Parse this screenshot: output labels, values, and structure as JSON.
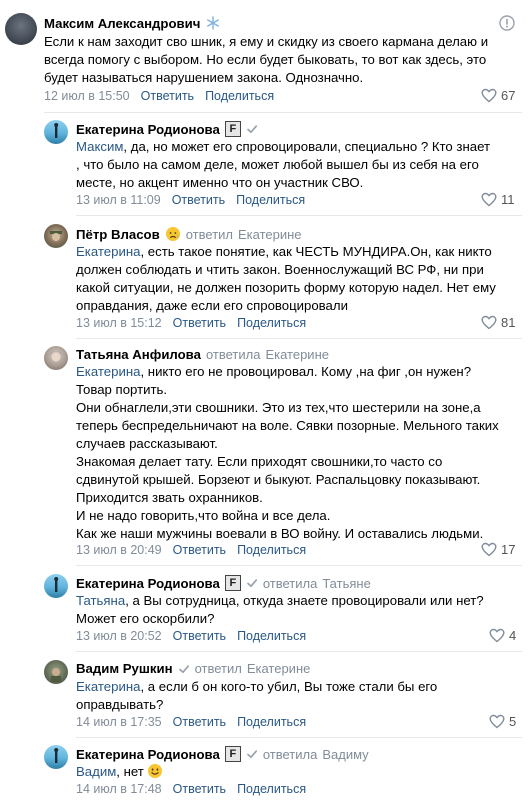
{
  "comments": [
    {
      "author": "Максим Александрович",
      "reply_prefix": "",
      "reply_to": "",
      "mention": "",
      "paragraphs": [
        "Если к нам заходит сво шник, я ему и скидку из своего кармана делаю и всегда помогу с выбором. Но если будет быковать, то вот как здесь, это будет называться нарушением закона. Однозначно."
      ],
      "date": "12 июл в 15:50",
      "reply_label": "Ответить",
      "share_label": "Поделиться",
      "likes": "67"
    },
    {
      "author": "Екатерина Родионова",
      "reply_prefix": "",
      "reply_to": "",
      "mention": "Максим",
      "paragraphs": [
        ", да, но может его спровоцировали, специально ? Кто знает , что было на самом деле, может любой вышел бы из себя на его месте, но акцент именно что он участник СВО."
      ],
      "date": "13 июл в 11:09",
      "reply_label": "Ответить",
      "share_label": "Поделиться",
      "likes": "11"
    },
    {
      "author": "Пётр Власов",
      "reply_prefix": "ответил",
      "reply_to": "Екатерине",
      "mention": "Екатерина",
      "paragraphs": [
        ", есть такое понятие, как ЧЕСТЬ МУНДИРА.Он, как никто должен соблюдать и чтить закон. Военнослужащий ВС РФ, ни при какой ситуации, не должен позорить форму которую надел. Нет ему оправдания, даже если его спровоцировали"
      ],
      "date": "13 июл в 15:12",
      "reply_label": "Ответить",
      "share_label": "Поделиться",
      "likes": "81"
    },
    {
      "author": "Татьяна Анфилова",
      "reply_prefix": "ответила",
      "reply_to": "Екатерине",
      "mention": "Екатерина",
      "paragraphs": [
        ", никто его не провоцировал. Кому ,на фиг ,он нужен? Товар портить.",
        "Они обнаглели,эти свошники. Это из тех,что шестерили на зоне,а теперь беспредельничают на воле. Сявки позорные. Мельного таких случаев рассказывают.",
        "Знакомая делает тату. Если приходят свошники,то часто со сдвинутой крышей. Борзеют и быкуют. Распальцовку показывают. Приходится звать охранников.",
        "И не надо говорить,что война и все дела.",
        "Как же наши мужчины воевали в ВО войну. И оставались людьми."
      ],
      "date": "13 июл в 20:49",
      "reply_label": "Ответить",
      "share_label": "Поделиться",
      "likes": "17"
    },
    {
      "author": "Екатерина Родионова",
      "reply_prefix": "ответила",
      "reply_to": "Татьяне",
      "mention": "Татьяна",
      "paragraphs": [
        ", а Вы сотрудница, откуда знаете провоцировали или нет? Может его оскорбили?"
      ],
      "date": "13 июл в 20:52",
      "reply_label": "Ответить",
      "share_label": "Поделиться",
      "likes": "4"
    },
    {
      "author": "Вадим Рушкин",
      "reply_prefix": "ответил",
      "reply_to": "Екатерине",
      "mention": "Екатерина",
      "paragraphs": [
        ", а если б он кого-то убил, Вы тоже стали бы его оправдывать?"
      ],
      "date": "14 июл в 17:35",
      "reply_label": "Ответить",
      "share_label": "Поделиться",
      "likes": "5"
    },
    {
      "author": "Екатерина Родионова",
      "reply_prefix": "ответила",
      "reply_to": "Вадиму",
      "mention": "Вадим",
      "paragraphs": [
        ", нет"
      ],
      "date": "14 июл в 17:48",
      "reply_label": "Ответить",
      "share_label": "Поделиться",
      "likes": ""
    }
  ],
  "badges": {
    "f_label": "F"
  },
  "colors": {
    "link": "#2a5885",
    "muted": "#818c99",
    "divider": "#e7e8ec"
  }
}
